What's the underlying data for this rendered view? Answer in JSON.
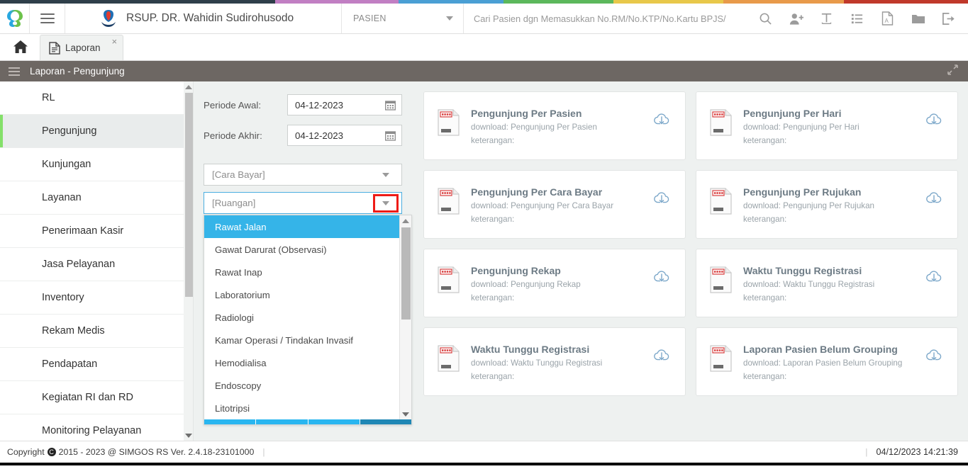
{
  "stripe_colors": [
    "#2f3f4a",
    "#c17fc3",
    "#4a9fd4",
    "#5cb85c",
    "#e8c84a",
    "#e89a4a",
    "#c0392b"
  ],
  "topbar": {
    "logo_icon": "simgos-logo-icon",
    "menu_icon": "hamburger-icon",
    "hospital_icon": "hospital-emblem-icon",
    "hospital_name": "RSUP. DR. Wahidin Sudirohusodo",
    "context_selector": {
      "value": "PASIEN",
      "icon": "chevron-down-icon"
    },
    "search": {
      "placeholder": "Cari Pasien dgn Memasukkan No.RM/No.KTP/No.Kartu BPJS/",
      "value": ""
    },
    "icons": [
      "search-icon",
      "add-user-icon",
      "text-tool-icon",
      "list-icon",
      "pdf-icon",
      "folder-icon",
      "logout-icon"
    ]
  },
  "tabbar": {
    "home_icon": "home-icon",
    "tabs": [
      {
        "label": "Laporan",
        "icon": "document-icon",
        "close": "×",
        "active": true
      }
    ]
  },
  "breadcrumb": {
    "menu_icon": "hamburger-icon",
    "title": "Laporan - Pengunjung",
    "expand_icon": "expand-arrows-icon"
  },
  "sidebar": {
    "items": [
      {
        "label": "RL",
        "active": false
      },
      {
        "label": "Pengunjung",
        "active": true
      },
      {
        "label": "Kunjungan",
        "active": false
      },
      {
        "label": "Layanan",
        "active": false
      },
      {
        "label": "Penerimaan Kasir",
        "active": false
      },
      {
        "label": "Jasa Pelayanan",
        "active": false
      },
      {
        "label": "Inventory",
        "active": false
      },
      {
        "label": "Rekam Medis",
        "active": false
      },
      {
        "label": "Pendapatan",
        "active": false
      },
      {
        "label": "Kegiatan RI dan RD",
        "active": false
      },
      {
        "label": "Monitoring Pelayanan",
        "active": false
      }
    ],
    "active_accent": "#84e06a",
    "scroll_up_icon": "scroll-up-arrow-icon",
    "scroll_down_icon": "scroll-down-arrow-icon"
  },
  "form": {
    "periode_awal": {
      "label": "Periode Awal:",
      "value": "04-12-2023",
      "icon": "calendar-icon"
    },
    "periode_akhir": {
      "label": "Periode Akhir:",
      "value": "04-12-2023",
      "icon": "calendar-icon"
    },
    "cara_bayar": {
      "value": "[Cara Bayar]",
      "icon": "chevron-down-icon"
    },
    "ruangan": {
      "value": "[Ruangan]",
      "icon": "chevron-down-icon",
      "focused": true,
      "highlight_color": "#ee1c17"
    },
    "dropdown": {
      "selected": "Rawat Jalan",
      "highlight_color": "#35b4e8",
      "options": [
        "Rawat Jalan",
        "Gawat Darurat (Observasi)",
        "Rawat Inap",
        "Laboratorium",
        "Radiologi",
        "Kamar Operasi / Tindakan Invasif",
        "Hemodialisa",
        "Endoscopy",
        "Litotripsi"
      ],
      "progress_segments": [
        "#29b6f0",
        "#29b6f0",
        "#29b6f0",
        "#1f87b5"
      ]
    }
  },
  "cards": [
    {
      "title": "Pengunjung Per Pasien",
      "download": "download: Pengunjung Per Pasien",
      "note": "keterangan:",
      "icon": "report-document-icon",
      "action_icon": "cloud-download-icon"
    },
    {
      "title": "Pengunjung Per Hari",
      "download": "download: Pengunjung Per Hari",
      "note": "keterangan:",
      "icon": "report-document-icon",
      "action_icon": "cloud-download-icon"
    },
    {
      "title": "Pengunjung Per Cara Bayar",
      "download": "download: Pengunjung Per Cara Bayar",
      "note": "keterangan:",
      "icon": "report-document-icon",
      "action_icon": "cloud-download-icon"
    },
    {
      "title": "Pengunjung Per Rujukan",
      "download": "download: Pengunjung Per Rujukan",
      "note": "keterangan:",
      "icon": "report-document-icon",
      "action_icon": "cloud-download-icon"
    },
    {
      "title": "Pengunjung Rekap",
      "download": "download: Pengunjung Rekap",
      "note": "keterangan:",
      "icon": "report-document-icon",
      "action_icon": "cloud-download-icon"
    },
    {
      "title": "Waktu Tunggu Registrasi",
      "download": "download: Waktu Tunggu Registrasi",
      "note": "keterangan:",
      "icon": "report-document-icon",
      "action_icon": "cloud-download-icon"
    },
    {
      "title": "Waktu Tunggu Registrasi",
      "download": "download: Waktu Tunggu Registrasi",
      "note": "keterangan:",
      "icon": "report-document-icon",
      "action_icon": "cloud-download-icon"
    },
    {
      "title": "Laporan Pasien Belum Grouping",
      "download": "download: Laporan Pasien Belum Grouping",
      "note": "keterangan:",
      "icon": "report-document-icon",
      "action_icon": "cloud-download-icon"
    }
  ],
  "footer": {
    "copyright_prefix": "Copyright",
    "copyright_symbol": "C",
    "copyright_text": "2015 - 2023 @ SIMGOS RS Ver. 2.4.18-23101000",
    "datetime": "04/12/2023 14:21:39"
  }
}
